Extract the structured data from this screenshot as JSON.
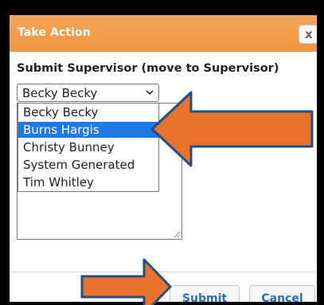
{
  "dialog": {
    "title": "Take Action",
    "close_label": "x",
    "section_label": "Submit Supervisor (move to Supervisor)",
    "select": {
      "value": "Becky Becky",
      "options": [
        "Becky Becky",
        "Burns Hargis",
        "Christy Bunney",
        "System Generated",
        "Tim Whitley"
      ],
      "highlighted": "Burns Hargis"
    },
    "buttons": {
      "submit": "Submit",
      "cancel": "Cancel"
    }
  },
  "colors": {
    "titlebar": "#ef9640",
    "annotation_arrow": "#e8732a",
    "highlight": "#1e78e6",
    "button_text": "#2a6ebb"
  },
  "icons": [
    "chevron-down-icon",
    "close-icon",
    "resize-grip-icon",
    "annotation-arrow-icon"
  ]
}
